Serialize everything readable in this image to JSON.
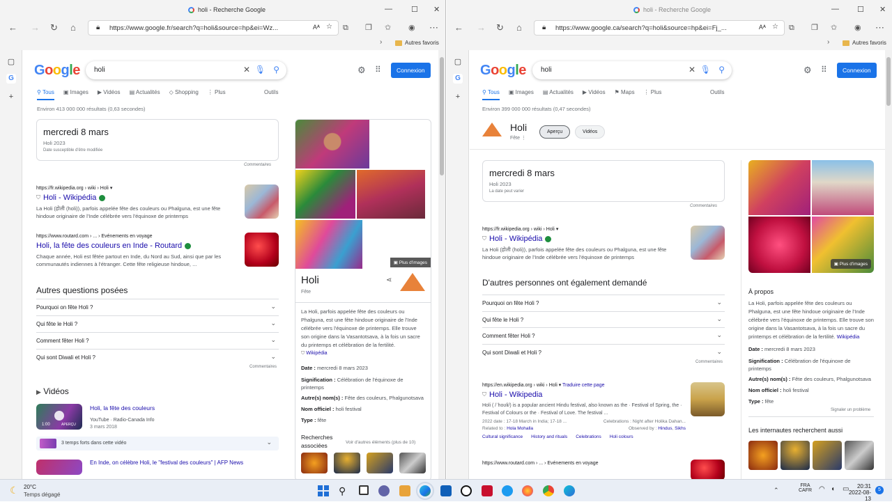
{
  "left": {
    "title": "holi - Recherche Google",
    "url": "https://www.google.fr/search?q=holi&source=hp&ei=Wz...",
    "favorites": "Autres favoris",
    "query": "holi",
    "connect": "Connexion",
    "tabs": [
      "Tous",
      "Images",
      "Vidéos",
      "Actualités",
      "Shopping",
      "Plus"
    ],
    "tools": "Outils",
    "stats": "Environ 413 000 000 résultats (0,63 secondes)",
    "date_card": {
      "date": "mercredi 8 mars",
      "sub": "Holi 2023",
      "note": "Date susceptible d'être modifiée",
      "feedback": "Commentaires"
    },
    "results": [
      {
        "cite": "https://fr.wikipedia.org › wiki › Holi",
        "title": "Holi - Wikipédia",
        "snippet": "La Holi (होली (holi)), parfois appelée fête des couleurs ou Phalguna, est une fête hindoue originaire de l'Inde célébrée vers l'équinoxe de printemps"
      },
      {
        "cite": "https://www.routard.com › ... › Evénements en voyage",
        "title": "Holi, la fête des couleurs en Inde - Routard",
        "snippet": "Chaque année, Holi est fêtée partout en Inde, du Nord au Sud, ainsi que par les communautés indiennes à l'étranger. Cette fête religieuse hindoue, ..."
      }
    ],
    "paa_title": "Autres questions posées",
    "paa": [
      "Pourquoi on fête Holi ?",
      "Qui fête le Holi ?",
      "Comment fêter Holi ?",
      "Qui sont Diwali et Holi ?"
    ],
    "paa_feedback": "Commentaires",
    "videos_title": "Vidéos",
    "video": {
      "title": "Holi, la fête des couleurs",
      "source": "YouTube · Radio-Canada Info",
      "date": "3 mars 2018",
      "duration": "1:00",
      "tag": "APERÇU",
      "moments": "3 temps forts dans cette vidéo"
    },
    "video2": "En Inde, on célèbre Holi, le \"festival des couleurs\" | AFP News",
    "kp": {
      "more_images": "Plus d'images",
      "title": "Holi",
      "subtitle": "Fête",
      "desc": "La Holi, parfois appelée fête des couleurs ou Phalguna, est une fête hindoue originaire de l'Inde célébrée vers l'équinoxe de printemps. Elle trouve son origine dans la Vasantotsava, à la fois un sacre du printemps et célébration de la fertilité.",
      "wiki": "Wikipédia",
      "facts": [
        {
          "k": "Date :",
          "v": "mercredi 8 mars 2023"
        },
        {
          "k": "Signification :",
          "v": "Célébration de l'équinoxe de printemps"
        },
        {
          "k": "Autre(s) nom(s) :",
          "v": "Fête des couleurs, Phalgunotsava"
        },
        {
          "k": "Nom officiel :",
          "v": "holi festival"
        },
        {
          "k": "Type :",
          "v": "fête"
        }
      ],
      "related": "Recherches associées",
      "related_more": "Voir d'autres éléments (plus de 10)"
    }
  },
  "right": {
    "title": "holi - Recherche Google",
    "url": "https://www.google.ca/search?q=holi&source=hp&ei=Fj_...",
    "favorites": "Autres favoris",
    "query": "holi",
    "connect": "Connexion",
    "tabs": [
      "Tous",
      "Images",
      "Actualités",
      "Vidéos",
      "Maps",
      "Plus"
    ],
    "tools": "Outils",
    "stats": "Environ 399 000 000 résultats (0,47 secondes)",
    "entity": {
      "name": "Holi",
      "type": "Fête",
      "chip1": "Aperçu",
      "chip2": "Vidéos"
    },
    "date_card": {
      "date": "mercredi 8 mars",
      "sub": "Holi 2023",
      "note": "La date peut varier",
      "feedback": "Commentaires"
    },
    "results": [
      {
        "cite": "https://fr.wikipedia.org › wiki › Holi",
        "title": "Holi - Wikipédia",
        "snippet": "La Holi (होली (holi)), parfois appelée fête des couleurs ou Phalguna, est une fête hindoue originaire de l'Inde célébrée vers l'équinoxe de printemps"
      }
    ],
    "paa_title": "D'autres personnes ont également demandé",
    "paa": [
      "Pourquoi on fête Holi ?",
      "Qui fête le Holi ?",
      "Comment fêter Holi ?",
      "Qui sont Diwali et Holi ?"
    ],
    "paa_feedback": "Commentaires",
    "en_result": {
      "cite": "https://en.wikipedia.org › wiki › Holi",
      "translate": "Traduire cette page",
      "title": "Holi - Wikipedia",
      "snippet": "Holi ( /ˈhoʊli/) is a popular ancient Hindu festival, also known as the · Festival of Spring, the · Festival of Colours or the · Festival of Love. The festival ...",
      "meta1": "2022 date : 17-18 March in India; 17-18 ...",
      "meta2": "Celebrations : Night after Holika Dahan...",
      "related_to": "Related to :",
      "rel1": "Hola Mohalla",
      "observed": "Observed by :",
      "obs1": "Hindus",
      "obs2": "Sikhs",
      "links": [
        "Cultural significance",
        "History and rituals",
        "Celebrations",
        "Holi colours"
      ]
    },
    "routard_cite": "https://www.routard.com › ... › Evénements en voyage",
    "kp": {
      "more_images": "Plus d'images",
      "about": "À propos",
      "desc": "La Holi, parfois appelée fête des couleurs ou Phalguna, est une fête hindoue originaire de l'Inde célébrée vers l'équinoxe de printemps. Elle trouve son origine dans la Vasantotsava, à la fois un sacre du printemps et célébration de la fertilité.",
      "wiki": "Wikipédia",
      "facts": [
        {
          "k": "Date :",
          "v": "mercredi 8 mars 2023"
        },
        {
          "k": "Signification :",
          "v": "Célébration de l'équinoxe de printemps"
        },
        {
          "k": "Autre(s) nom(s) :",
          "v": "Fête des couleurs, Phalgunotsava"
        },
        {
          "k": "Nom officiel :",
          "v": "holi festival"
        },
        {
          "k": "Type :",
          "v": "fête"
        }
      ],
      "report": "Signaler un problème",
      "also": "Les internautes recherchent aussi"
    }
  },
  "taskbar": {
    "weather_temp": "20°C",
    "weather_desc": "Temps dégagé",
    "lang": "FRA",
    "lang2": "CAFR",
    "time": "20:31",
    "date": "2022-08-13",
    "notif": "5"
  }
}
